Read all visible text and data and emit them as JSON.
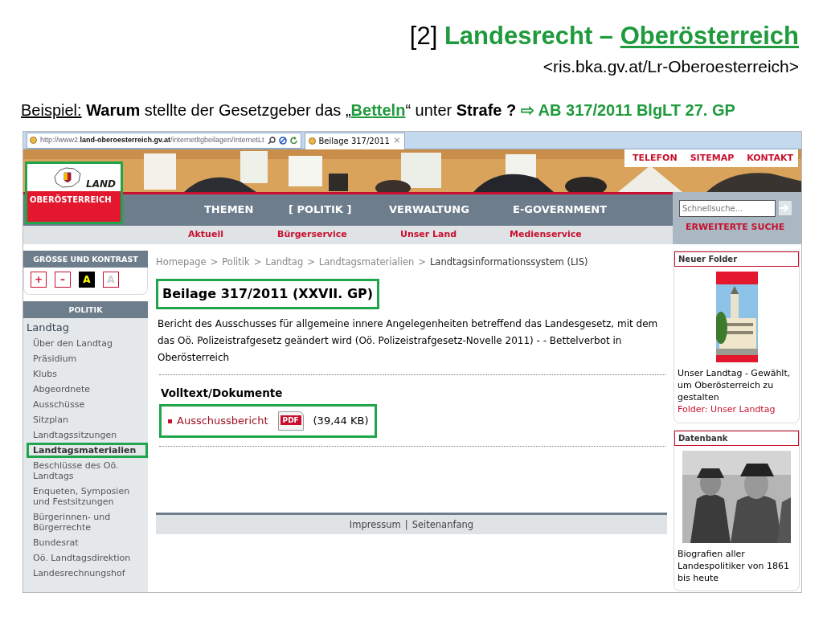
{
  "slide": {
    "title_parts": [
      {
        "kind": "plain",
        "text": "[2] "
      },
      {
        "kind": "accent",
        "text": "Landesrecht – "
      },
      {
        "kind": "link",
        "text": "Oberösterreich"
      }
    ],
    "source": "<ris.bka.gv.at/Lr-Oberoesterreich>",
    "example_parts": [
      {
        "kind": "underline",
        "text": "Beispiel:"
      },
      {
        "kind": "bold",
        "text": " Warum"
      },
      {
        "kind": "plain",
        "text": " stellte der Gesetzgeber das „"
      },
      {
        "kind": "link",
        "text": "Betteln"
      },
      {
        "kind": "plain",
        "text": "“  unter "
      },
      {
        "kind": "bold",
        "text": "Strafe ? "
      },
      {
        "kind": "accent",
        "text": "⇨ AB 317/2011 BlgLT 27. GP"
      }
    ]
  },
  "browser": {
    "address": "http://www2.**land-oberoesterreich.gv.at**/internetltgbeilagen/InternetLt",
    "tab": {
      "title": "Beilage 317/2011",
      "close": "×"
    }
  },
  "header": {
    "logo": {
      "top": "LAND",
      "bottom": "OBERÖSTERREICH",
      "highlighted": true
    },
    "top_links": [
      "TELEFON",
      "SITEMAP",
      "KONTAKT"
    ],
    "nav": [
      "THEMEN",
      "[ POLITIK ]",
      "VERWALTUNG",
      "E-GOVERNMENT"
    ],
    "subnav": [
      "Aktuell",
      "Bürgerservice",
      "Unser Land",
      "Medienservice"
    ],
    "search": {
      "placeholder": "Schnellsuche...",
      "advanced": "ERWEITERTE SUCHE"
    }
  },
  "sidebar": {
    "contrast_title": "GRÖSSE UND KONTRAST",
    "contrast_buttons": [
      {
        "label": "+",
        "kind": "plus"
      },
      {
        "label": "–",
        "kind": "minus"
      },
      {
        "label": "A",
        "kind": "dark"
      },
      {
        "label": "A",
        "kind": "light"
      }
    ],
    "section_title": "POLITIK",
    "heading": "Landtag",
    "items": [
      {
        "label": "Über den Landtag",
        "selected": false,
        "highlighted": false
      },
      {
        "label": "Präsidium",
        "selected": false,
        "highlighted": false
      },
      {
        "label": "Klubs",
        "selected": false,
        "highlighted": false
      },
      {
        "label": "Abgeordnete",
        "selected": false,
        "highlighted": false
      },
      {
        "label": "Ausschüsse",
        "selected": false,
        "highlighted": false
      },
      {
        "label": "Sitzplan",
        "selected": false,
        "highlighted": false
      },
      {
        "label": "Landtagssitzungen",
        "selected": false,
        "highlighted": false
      },
      {
        "label": "Landtagsmaterialien",
        "selected": true,
        "highlighted": true
      },
      {
        "label": "Beschlüsse des Oö. Landtags",
        "selected": false,
        "highlighted": false
      },
      {
        "label": "Enqueten, Symposien und Festsitzungen",
        "selected": false,
        "highlighted": false
      },
      {
        "label": "Bürgerinnen- und Bürgerrechte",
        "selected": false,
        "highlighted": false
      },
      {
        "label": "Bundesrat",
        "selected": false,
        "highlighted": false
      },
      {
        "label": "Oö. Landtagsdirektion",
        "selected": false,
        "highlighted": false
      },
      {
        "label": "Landesrechnungshof",
        "selected": false,
        "highlighted": false
      }
    ]
  },
  "main": {
    "breadcrumb": [
      "Homepage",
      "Politik",
      "Landtag",
      "Landtagsmaterialien",
      "Landtagsinformationssystem (LIS)"
    ],
    "separators": [
      ">",
      ">",
      ">",
      ">"
    ],
    "heading": "Beilage 317/2011 (XXVII. GP)",
    "heading_highlighted": true,
    "description": "Bericht des Ausschusses für allgemeine innere Angelegenheiten betreffend das Landesgesetz, mit dem das Oö. Polizeistrafgesetz geändert wird (Oö. Polizeistrafgesetz-Novelle 2011) - - Bettelverbot in Oberösterreich",
    "documents_title": "Volltext/Dokumente",
    "documents": [
      {
        "label": "Ausschussbericht",
        "badge": "PDF",
        "size": "(39,44 KB)",
        "highlighted": true
      }
    ],
    "footer": [
      "Impressum",
      "|",
      "Seitenanfang"
    ]
  },
  "right": [
    {
      "title": "Neuer Folder",
      "kind": "folder",
      "text": "Unser Landtag - Gewählt, um Oberösterreich zu gestalten",
      "link": "Folder: Unser Landtag"
    },
    {
      "title": "Datenbank",
      "text": "Biografien aller Landespolitiker von 1861 bis heute"
    }
  ]
}
